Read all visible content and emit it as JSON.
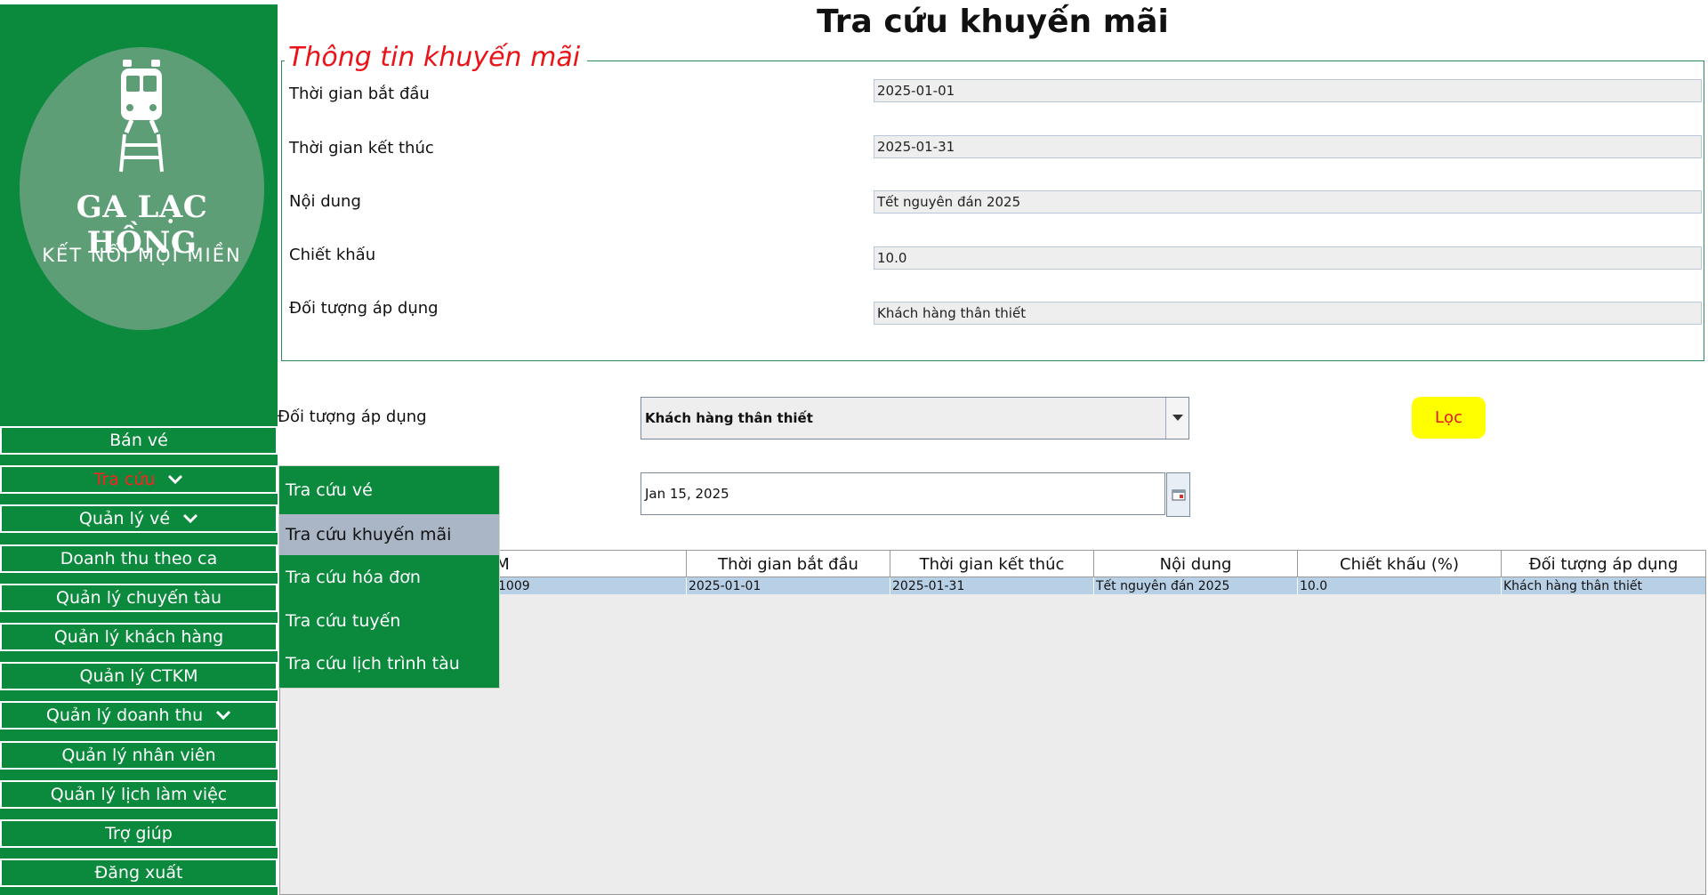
{
  "title": "Tra cứu khuyến mãi",
  "logo": {
    "name": "GA LẠC HỒNG",
    "slogan": "KẾT NỐI MỌI MIỀN"
  },
  "sidebar": {
    "items": [
      {
        "label": "Bán vé",
        "has_chevron": false
      },
      {
        "label": "Tra cứu",
        "has_chevron": true,
        "active": true
      },
      {
        "label": "Quản lý vé",
        "has_chevron": true
      },
      {
        "label": "Doanh thu theo ca",
        "has_chevron": false
      },
      {
        "label": "Quản lý chuyến tàu",
        "has_chevron": false
      },
      {
        "label": "Quản lý khách hàng",
        "has_chevron": false
      },
      {
        "label": "Quản lý CTKM",
        "has_chevron": false
      },
      {
        "label": "Quản lý doanh thu",
        "has_chevron": true
      },
      {
        "label": "Quản lý nhân viên",
        "has_chevron": false
      },
      {
        "label": "Quản lý lịch làm việc",
        "has_chevron": false
      },
      {
        "label": "Trợ giúp",
        "has_chevron": false
      },
      {
        "label": "Đăng xuất",
        "has_chevron": false
      }
    ]
  },
  "submenu": {
    "items": [
      {
        "label": "Tra cứu vé"
      },
      {
        "label": "Tra cứu khuyến mãi",
        "selected": true
      },
      {
        "label": "Tra cứu hóa đơn"
      },
      {
        "label": "Tra cứu tuyến"
      },
      {
        "label": "Tra cứu lịch trình tàu"
      }
    ]
  },
  "info": {
    "legend": "Thông tin khuyến mãi",
    "fields": [
      {
        "label": "Thời gian bắt đầu",
        "value": "2025-01-01"
      },
      {
        "label": "Thời gian kết thúc",
        "value": "2025-01-31"
      },
      {
        "label": "Nội dung",
        "value": "Tết nguyên đán 2025"
      },
      {
        "label": "Chiết khấu",
        "value": "10.0"
      },
      {
        "label": "Đối tượng áp dụng",
        "value": "Khách hàng thân thiết"
      }
    ]
  },
  "filter": {
    "label": "Đối tượng áp dụng",
    "selected": "Khách hàng thân thiết",
    "button_label": "Lọc",
    "date_value": "Jan 15, 2025"
  },
  "table": {
    "columns": [
      "Mã KM",
      "Thời gian bắt đầu",
      "Thời gian kết thúc",
      "Nội dung",
      "Chiết khấu (%)",
      "Đối tượng áp dụng"
    ],
    "rows": [
      [
        "1009",
        "2025-01-01",
        "2025-01-31",
        "Tết nguyên đán 2025",
        "10.0",
        "Khách hàng thân thiết"
      ]
    ]
  },
  "colors": {
    "sidebar": "#0b8a3e",
    "accent_red": "#e8141a",
    "filter_button": "#ffff00",
    "selected_row": "#b8d0e6"
  }
}
